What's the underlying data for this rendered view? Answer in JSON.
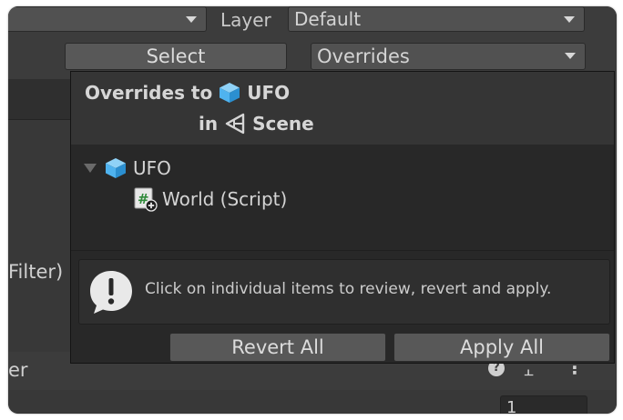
{
  "inspector": {
    "layer_label": "Layer",
    "layer_value": "Default",
    "select_label": "Select",
    "overrides_label": "Overrides",
    "filter_label": "Filter)",
    "component_header_suffix": "er",
    "number_field_value": "1"
  },
  "popup": {
    "header_prefix": "Overrides to",
    "target_name": "UFO",
    "in_label": "in",
    "scene_name": "Scene",
    "tree": [
      {
        "label": "UFO",
        "icon": "prefab-cube-icon"
      },
      {
        "label": "World (Script)",
        "icon": "script-added-icon"
      }
    ],
    "info_message": "Click on individual items to review, revert and apply.",
    "revert_all_label": "Revert All",
    "apply_all_label": "Apply All"
  },
  "colors": {
    "window_bg": "#3c3c3c",
    "popup_bg": "#282828",
    "prefab_blue": "#4fb3ef",
    "text": "#d4d4d4"
  }
}
